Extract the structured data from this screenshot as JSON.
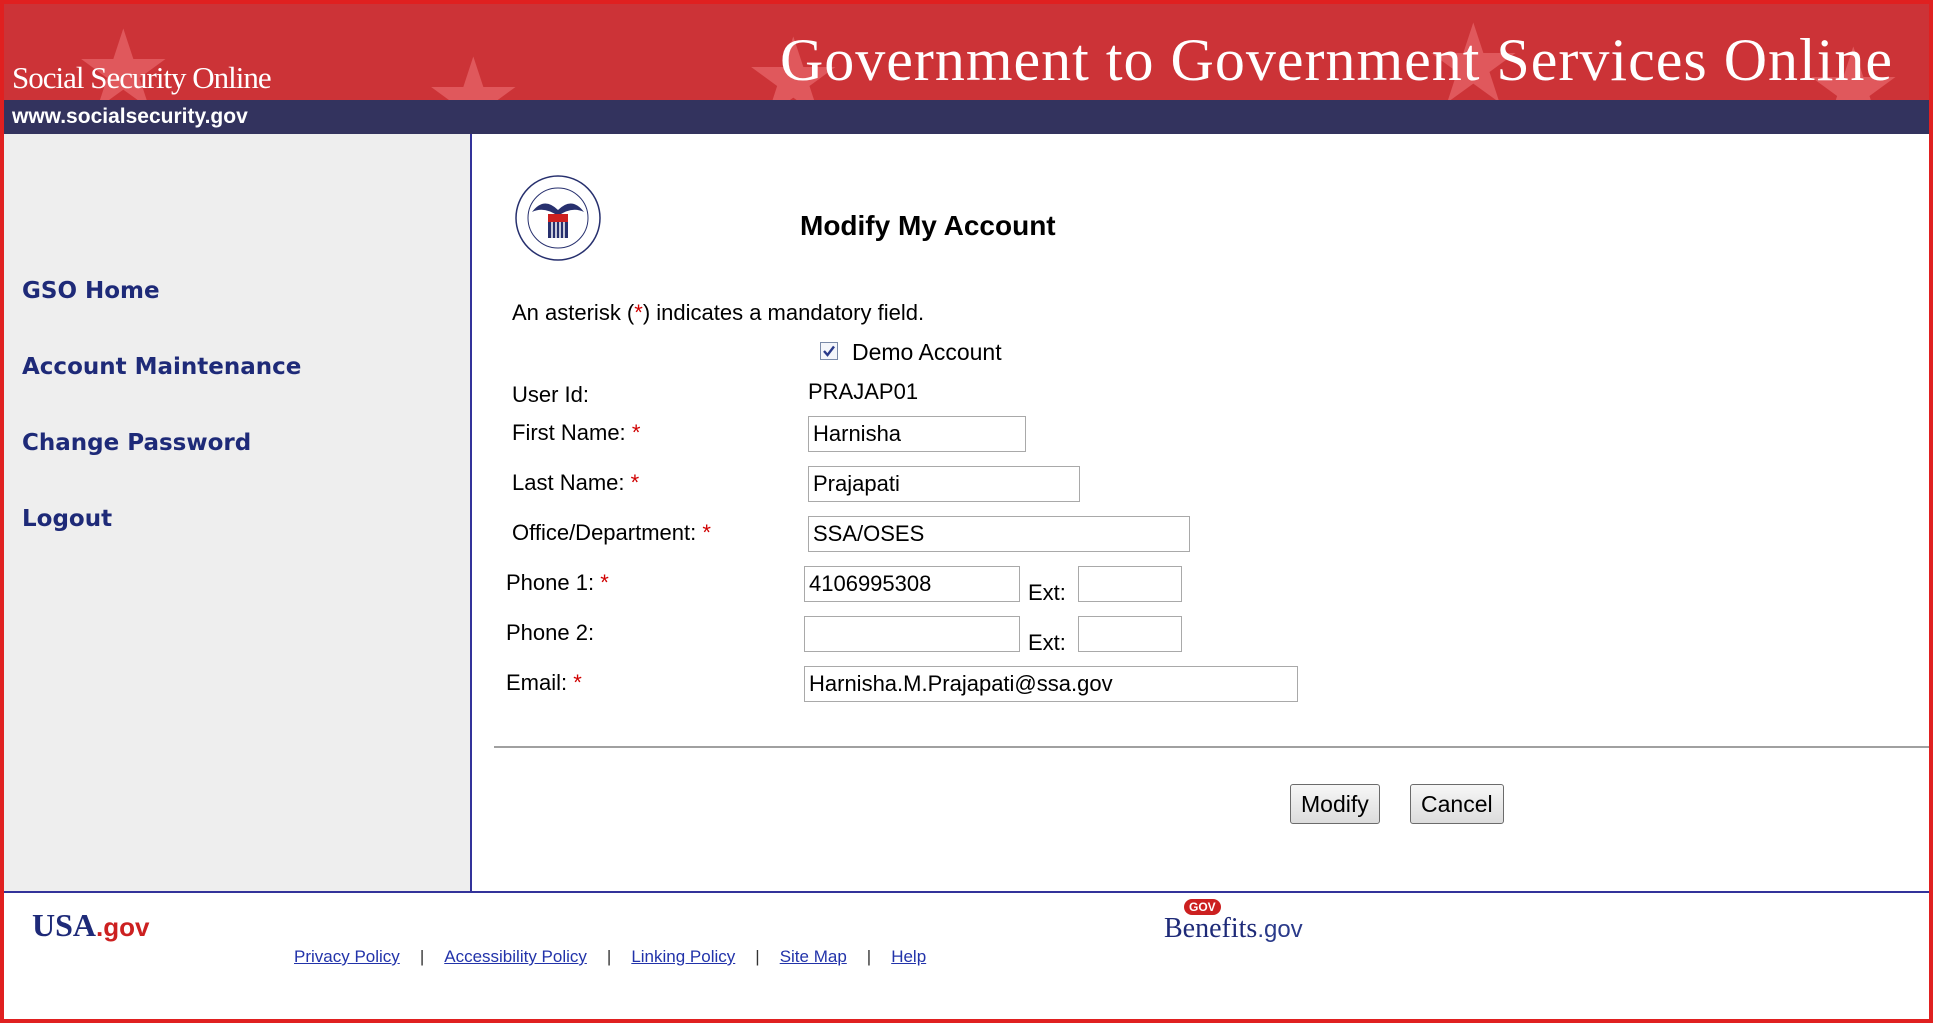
{
  "header": {
    "org_name": "Social Security Online",
    "site_title": "Government to Government Services Online",
    "url": "www.socialsecurity.gov"
  },
  "sidebar": {
    "items": [
      {
        "label": "GSO Home"
      },
      {
        "label": "Account Maintenance"
      },
      {
        "label": "Change Password"
      },
      {
        "label": "Logout"
      }
    ]
  },
  "main": {
    "page_title": "Modify My Account",
    "note": {
      "before": "An asterisk (",
      "asterisk": "*",
      "after": ") indicates a mandatory field."
    },
    "demo_account": {
      "label": "Demo Account",
      "checked": true
    },
    "user_id": {
      "label": "User Id:",
      "value": "PRAJAP01"
    },
    "first_name": {
      "label": "First Name:",
      "value": "Harnisha"
    },
    "last_name": {
      "label": "Last Name:",
      "value": "Prajapati"
    },
    "office": {
      "label": "Office/Department:",
      "value": "SSA/OSES"
    },
    "phone1": {
      "label": "Phone 1:",
      "value": "4106995308",
      "ext_label": "Ext:",
      "ext_value": ""
    },
    "phone2": {
      "label": "Phone 2:",
      "value": "",
      "ext_label": "Ext:",
      "ext_value": ""
    },
    "email": {
      "label": "Email:",
      "value": "Harnisha.M.Prajapati@ssa.gov"
    },
    "required_marker": "*",
    "buttons": {
      "modify": "Modify",
      "cancel": "Cancel"
    }
  },
  "footer": {
    "usa_logo": {
      "usa": "USA",
      "gov": ".gov"
    },
    "links": [
      "Privacy Policy",
      "Accessibility Policy",
      "Linking Policy",
      "Site Map",
      "Help"
    ],
    "benefits_logo": {
      "benefits": "Benefits",
      "gov": ".gov",
      "badge": "GOV"
    }
  },
  "colors": {
    "banner": "#cc3337",
    "urlbar": "#33335e",
    "nav_link": "#1e2a78",
    "required": "#d00000"
  }
}
